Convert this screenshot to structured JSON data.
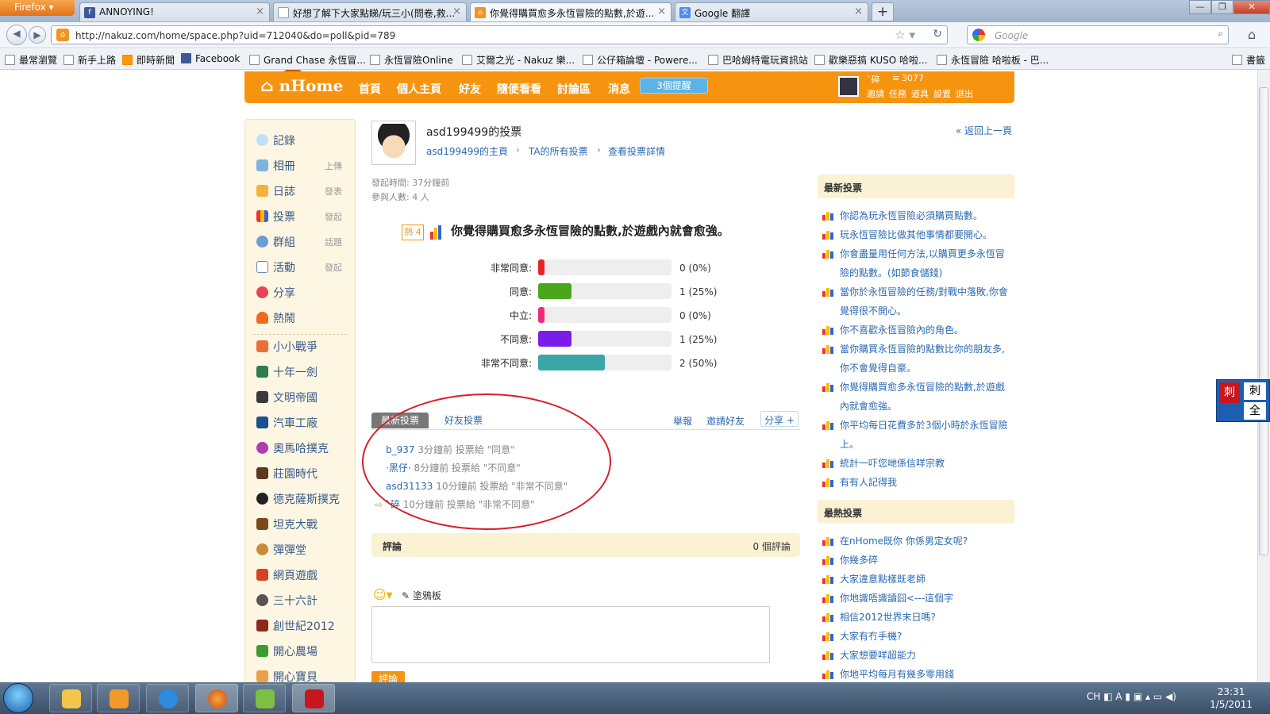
{
  "browser": {
    "firefox_label": "Firefox",
    "tabs": [
      {
        "label": "ANNOYING!",
        "icon": "facebook-icon"
      },
      {
        "label": "好想了解下大家點睇/玩三小(問卷,救...",
        "icon": "page-icon"
      },
      {
        "label": "你覺得購買愈多永恆冒險的點數,於遊...",
        "icon": "nakuz-icon"
      },
      {
        "label": "Google 翻譯",
        "icon": "google-translate-icon"
      }
    ],
    "url": "http://nakuz.com/home/space.php?uid=712040&do=poll&pid=789",
    "search_placeholder": "Google",
    "bookmarks": [
      {
        "label": "最常瀏覽"
      },
      {
        "label": "新手上路"
      },
      {
        "label": "即時新聞"
      },
      {
        "label": "Facebook"
      },
      {
        "label": "Grand Chase 永恆冒..."
      },
      {
        "label": "永恆冒險Online"
      },
      {
        "label": "艾爾之光 - Nakuz 樂..."
      },
      {
        "label": "公仔箱論壇 - Powere..."
      },
      {
        "label": "巴哈姆特電玩資訊站"
      },
      {
        "label": "歡樂惡搞 KUSO 哈啦..."
      },
      {
        "label": "永恆冒險 哈啦板 - 巴..."
      },
      {
        "label": "書籤"
      }
    ]
  },
  "site": {
    "logo": "nHome",
    "nav": [
      "首頁",
      "個人主頁",
      "好友",
      "隨便看看",
      "討論區",
      "消息"
    ],
    "remind": "3個提醒",
    "user_name": "`碎",
    "points": "3077",
    "user_links": [
      "邀請",
      "任務",
      "道具",
      "設置",
      "退出"
    ]
  },
  "sidebar": {
    "items": [
      {
        "label": "記錄",
        "sub": ""
      },
      {
        "label": "相冊",
        "sub": "上傳"
      },
      {
        "label": "日誌",
        "sub": "發表"
      },
      {
        "label": "投票",
        "sub": "發起"
      },
      {
        "label": "群組",
        "sub": "話題"
      },
      {
        "label": "活動",
        "sub": "發起"
      },
      {
        "label": "分享",
        "sub": ""
      },
      {
        "label": "熱鬧",
        "sub": ""
      }
    ],
    "apps": [
      "小小戰爭",
      "十年一劍",
      "文明帝國",
      "汽車工廠",
      "奧馬哈撲克",
      "莊園時代",
      "德克薩斯撲克",
      "坦克大戰",
      "彈彈堂",
      "網頁遊戲",
      "三十六計",
      "創世紀2012",
      "開心農場",
      "開心寶貝"
    ]
  },
  "poll": {
    "owner_title": "asd199499的投票",
    "back_link": "« 返回上一頁",
    "crumbs": [
      "asd199499的主頁",
      "TA的所有投票",
      "查看投票詳情"
    ],
    "start_time": "發起時間: 37分鐘前",
    "participants": "參與人數: 4 人",
    "hot": "熱 4",
    "question": "你覺得購買愈多永恆冒險的點數,於遊戲內就會愈強。",
    "result_tabs": [
      "最新投票",
      "好友投票"
    ],
    "actions": [
      "舉報",
      "邀請好友",
      "分享",
      "+"
    ],
    "votes": [
      {
        "user": "b_937",
        "text": "3分鐘前 投票給 \"同意\""
      },
      {
        "user": "·黑仔·",
        "text": "8分鐘前 投票給 \"不同意\""
      },
      {
        "user": "asd31133",
        "text": "10分鐘前 投票給 \"非常不同意\""
      },
      {
        "user": "`碎",
        "text": "10分鐘前 投票給 \"非常不同意\""
      }
    ],
    "comment_label": "評論",
    "comment_count": "0 個評論",
    "doodle": "塗鴉板",
    "submit": "評論"
  },
  "chart_data": {
    "type": "bar",
    "orientation": "horizontal",
    "categories": [
      "非常同意:",
      "同意:",
      "中立:",
      "不同意:",
      "非常不同意:"
    ],
    "values": [
      0,
      1,
      0,
      1,
      2
    ],
    "labels": [
      "0 (0%)",
      "1 (25%)",
      "0 (0%)",
      "1 (25%)",
      "2 (50%)"
    ],
    "percent": [
      0,
      25,
      0,
      25,
      50
    ],
    "colors": [
      "#e8242a",
      "#4aa61c",
      "#ee2a7b",
      "#7b1de8",
      "#3aa6a8"
    ],
    "xlim": [
      0,
      100
    ]
  },
  "right": {
    "latest_title": "最新投票",
    "latest": [
      "你認為玩永恆冒險必須購買點數。",
      "玩永恆冒險比做其他事情都要開心。",
      "你會盡量用任何方法,以購買更多永恆冒險的點數。(如節食儲錢)",
      "當你於永恆冒險的任務/對戰中落敗,你會覺得很不開心。",
      "你不喜歡永恆冒險內的角色。",
      "當你購買永恆冒險的點數比你的朋友多,你不會覺得自豪。",
      "你覺得購買愈多永恆冒險的點數,於遊戲內就會愈強。",
      "你平均每日花費多於3個小時於永恆冒險上。",
      "統計一吓您哋係信咩宗教",
      "有有人記得我"
    ],
    "hot_title": "最熱投票",
    "hot": [
      "在nHome既你 你係男定女呢?",
      "你幾多碎",
      "大家違意點樣既老師",
      "你地識唔識讀囧<---這個字",
      "相信2012世界末日嗎?",
      "大家有冇手機?",
      "大家想要咩超能力",
      "你地平均每月有幾多零用錢"
    ]
  },
  "taskbar": {
    "ime": "CH",
    "time": "23:31",
    "date": "1/5/2011"
  }
}
